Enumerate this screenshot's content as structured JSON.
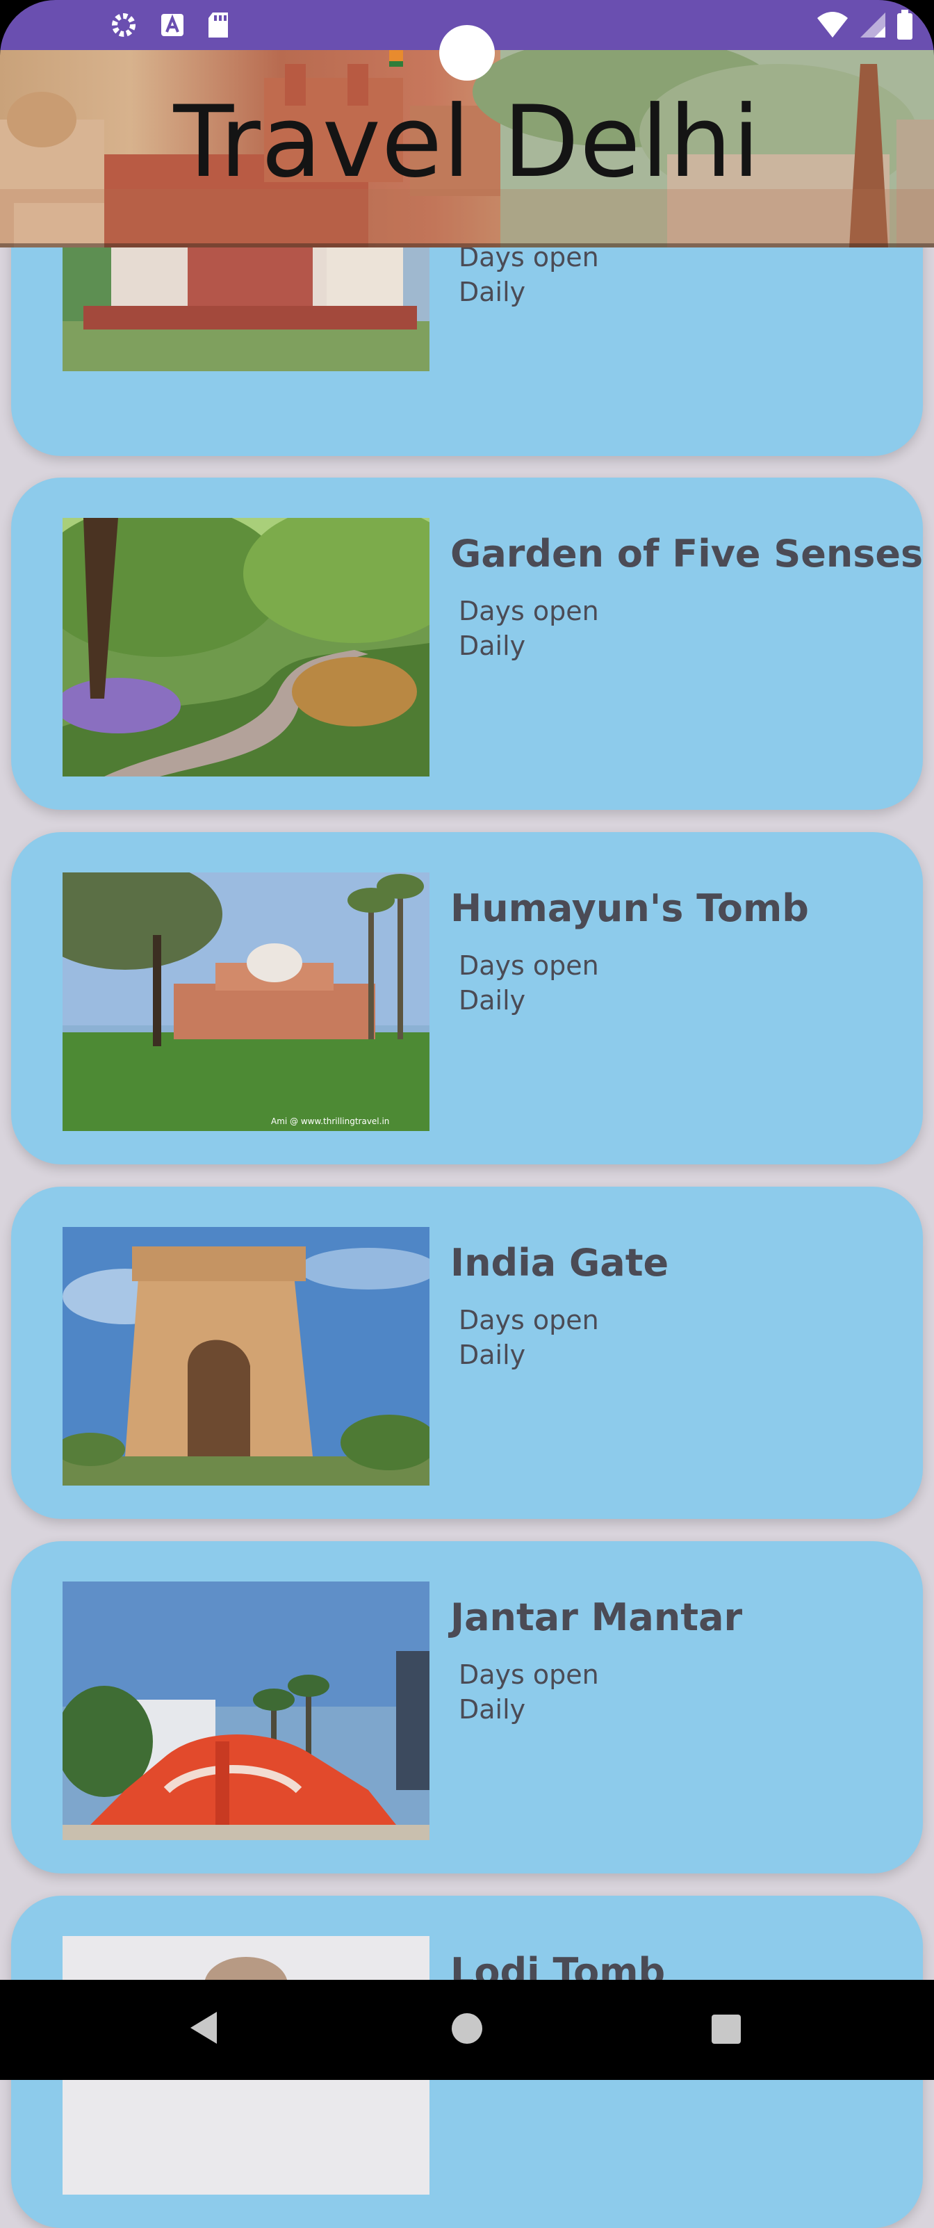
{
  "app": {
    "title": "Travel Delhi"
  },
  "status_bar": {
    "left_icons": [
      "gear-icon",
      "text-a-icon",
      "sd-card-icon"
    ],
    "right_icons": [
      "wifi-icon",
      "signal-icon",
      "battery-icon"
    ],
    "background_color": "#6a4fb0"
  },
  "places": [
    {
      "name": "",
      "days_label": "Days open",
      "days_value": "Daily",
      "image": "lotus-temple-style-mansion-photo"
    },
    {
      "name": "Garden of Five Senses",
      "days_label": "Days open",
      "days_value": "Daily",
      "image": "garden-path-photo"
    },
    {
      "name": "Humayun's Tomb",
      "days_label": "Days open",
      "days_value": "Daily",
      "image": "humayuns-tomb-photo"
    },
    {
      "name": "India Gate",
      "days_label": "Days open",
      "days_value": "Daily",
      "image": "india-gate-photo"
    },
    {
      "name": "Jantar Mantar",
      "days_label": "Days open",
      "days_value": "Daily",
      "image": "jantar-mantar-photo"
    },
    {
      "name": "Lodi Tomb",
      "days_label": "",
      "days_value": "",
      "image": "lodi-tomb-photo"
    }
  ],
  "thumb_watermark": "Ami @ www.thrillingtravel.in",
  "colors": {
    "card_background": "#8dcbeb",
    "page_background": "#d9d4dc",
    "text": "#4b4b55"
  },
  "nav_bar": {
    "icons": [
      "back-icon",
      "home-icon",
      "recents-icon"
    ]
  }
}
